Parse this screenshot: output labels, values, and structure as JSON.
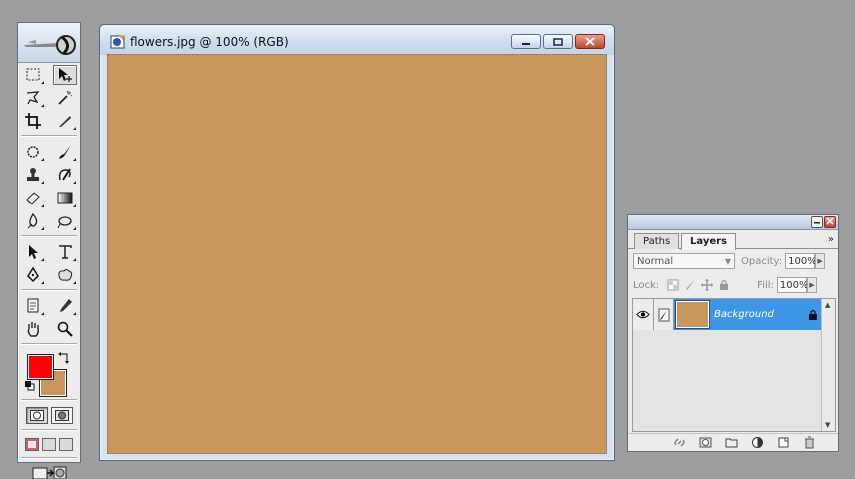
{
  "document": {
    "title": "flowers.jpg @ 100% (RGB)",
    "canvas_color": "#c8975b"
  },
  "toolbox": {
    "foreground_color": "#ff0000",
    "background_color": "#c8975b",
    "tools": [
      "rectangular-marquee",
      "move",
      "lasso",
      "magic-wand",
      "crop",
      "slice",
      "healing-brush",
      "brush",
      "clone-stamp",
      "history-brush",
      "eraser",
      "gradient",
      "blur",
      "dodge",
      "path-selection",
      "type",
      "pen",
      "custom-shape",
      "notes",
      "eyedropper",
      "hand",
      "zoom"
    ]
  },
  "layers_panel": {
    "tabs": [
      "Paths",
      "Layers"
    ],
    "active_tab": "Layers",
    "blend_mode": "Normal",
    "opacity_label": "Opacity:",
    "opacity_value": "100%",
    "lock_label": "Lock:",
    "fill_label": "Fill:",
    "fill_value": "100%",
    "layers": [
      {
        "name": "Background",
        "selected": true,
        "locked": true,
        "visible": true
      }
    ],
    "menu_glyph": "»"
  }
}
